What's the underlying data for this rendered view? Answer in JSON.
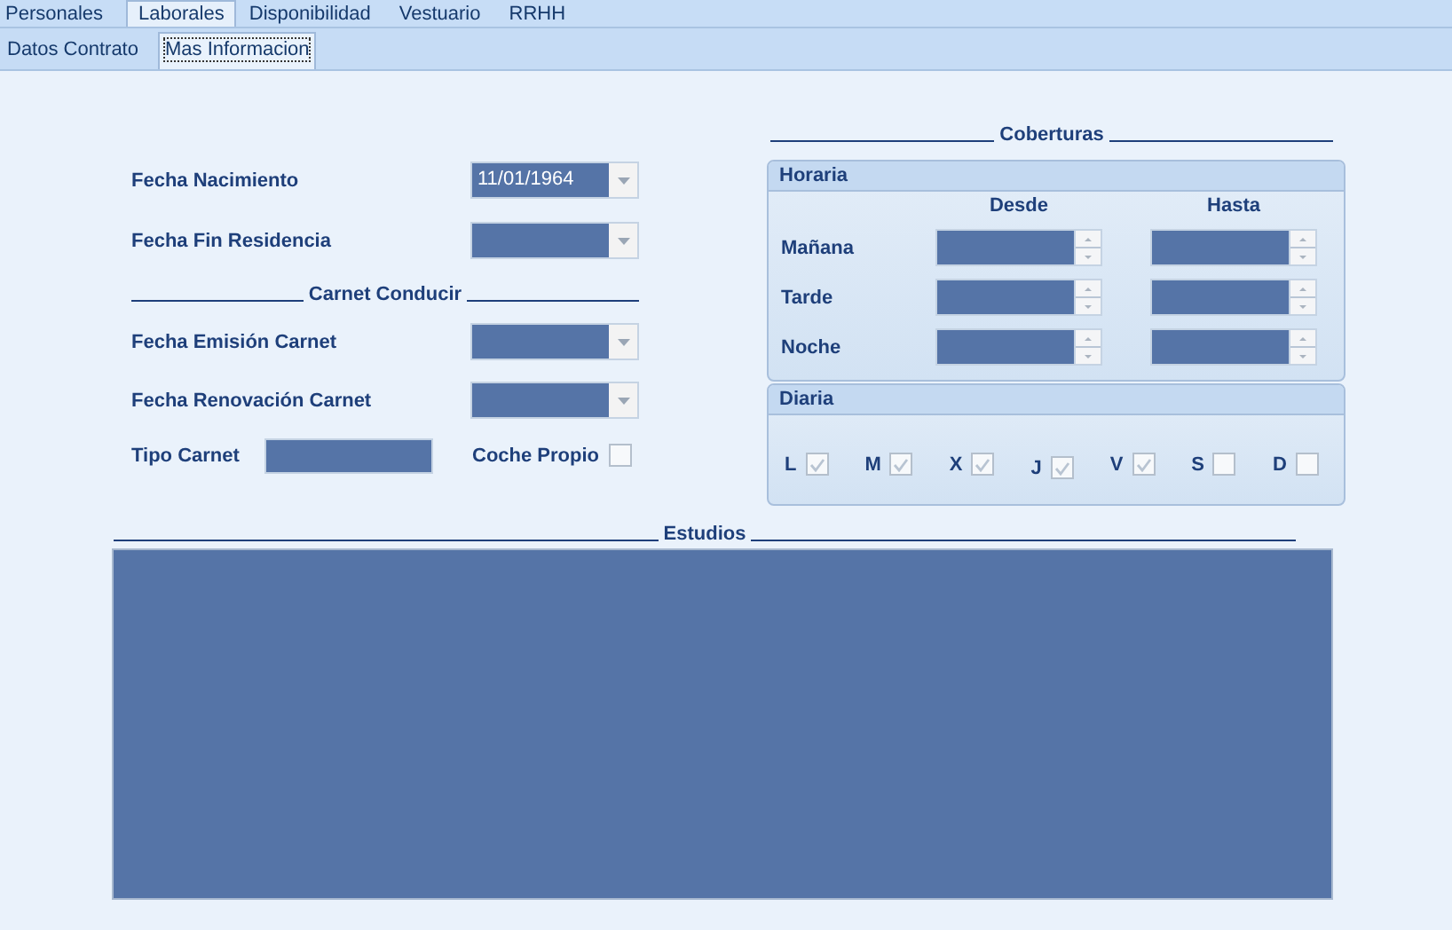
{
  "tabs": [
    {
      "label": "Personales",
      "selected": false
    },
    {
      "label": "Laborales",
      "selected": true
    },
    {
      "label": "Disponibilidad",
      "selected": false
    },
    {
      "label": "Vestuario",
      "selected": false
    },
    {
      "label": "RRHH",
      "selected": false
    }
  ],
  "subtabs": [
    {
      "label": "Datos Contrato",
      "selected": false
    },
    {
      "label": "Mas Informacion",
      "selected": true
    }
  ],
  "fields": [
    {
      "label": "Fecha Nacimiento",
      "value": "11/01/1964"
    },
    {
      "label": "Fecha Fin Residencia"
    }
  ],
  "carnet": {
    "title": "Carnet Conducir",
    "fields": [
      {
        "label": "Fecha Emisión Carnet"
      },
      {
        "label": "Fecha Renovación Carnet"
      }
    ],
    "tipo": {
      "label": "Tipo Carnet"
    },
    "coche_propio": {
      "label": "Coche Propio",
      "checked": false
    }
  },
  "coberturas": {
    "title": "Coberturas",
    "horaria": {
      "title": "Horaria",
      "columns": [
        "Desde",
        "Hasta"
      ],
      "rows": [
        {
          "label": "Mañana"
        },
        {
          "label": "Tarde"
        },
        {
          "label": "Noche"
        }
      ]
    },
    "diaria": {
      "title": "Diaria",
      "days": [
        {
          "label": "L",
          "checked": true
        },
        {
          "label": "M",
          "checked": true
        },
        {
          "label": "X",
          "checked": true
        },
        {
          "label": "J",
          "checked": true
        },
        {
          "label": "V",
          "checked": true
        },
        {
          "label": "S",
          "checked": false
        },
        {
          "label": "D",
          "checked": false
        }
      ]
    }
  },
  "estudios": {
    "title": "Estudios"
  }
}
